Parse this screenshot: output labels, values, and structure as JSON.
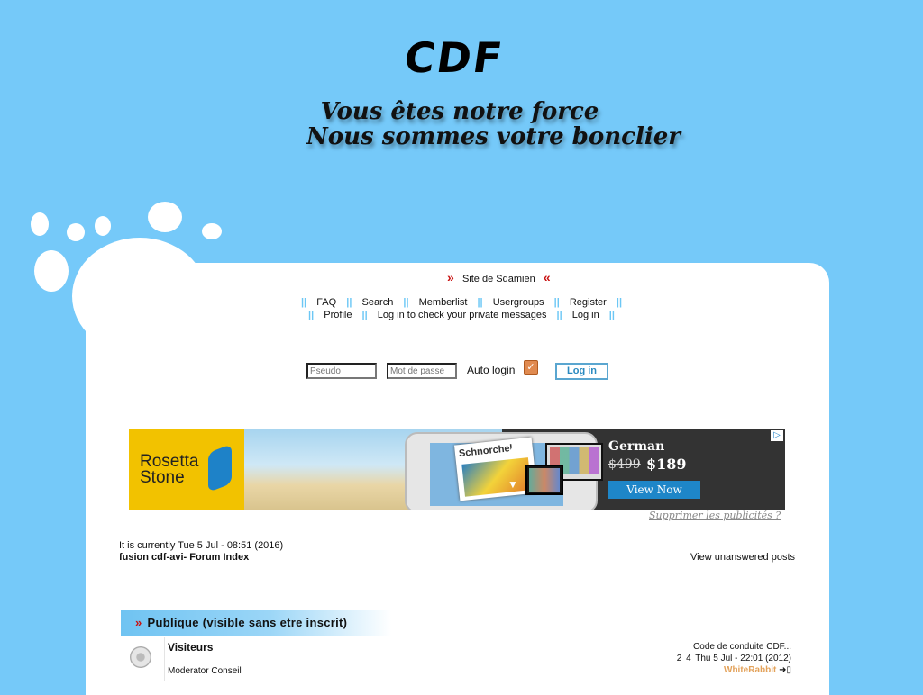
{
  "header": {
    "logo_text": "CDF",
    "slogan_line1": "Vous êtes notre force",
    "slogan_line2": "Nous sommes votre bonclier"
  },
  "site_link": {
    "arrow_left": "»",
    "label": "Site de Sdamien",
    "arrow_right": "«"
  },
  "nav": {
    "row1": [
      "FAQ",
      "Search",
      "Memberlist",
      "Usergroups",
      "Register"
    ],
    "row2": [
      "Profile",
      "Log in to check your private messages",
      "Log in"
    ],
    "separator": "||"
  },
  "login": {
    "username_placeholder": "Pseudo",
    "password_placeholder": "Mot de passe",
    "autologin_label": "Auto login",
    "autologin_checked": true,
    "button_label": "Log in"
  },
  "ad": {
    "brand": "Rosetta Stone",
    "tablet_label": "Schnorchel",
    "language": "German",
    "old_price": "$499",
    "new_price": "$189",
    "cta": "View Now",
    "remove_ads": "Supprimer les publicités ?"
  },
  "forum": {
    "current_time": "It is currently Tue 5 Jul - 08:51 (2016)",
    "index_title": "fusion cdf-avi- Forum Index",
    "view_unanswered": "View unanswered posts",
    "category": {
      "arrow": "»",
      "title": "Publique (visible sans etre inscrit)"
    },
    "rows": [
      {
        "name": "Visiteurs",
        "moderator": "Moderator Conseil",
        "last_topic": "Code de conduite CDF...",
        "topics": "2",
        "posts": "4",
        "last_date": "Thu 5 Jul - 22:01 (2012)",
        "last_user": "WhiteRabbit"
      }
    ]
  },
  "colors": {
    "background": "#75c9f9",
    "panel": "#ffffff",
    "accent_red": "#c81010",
    "user_orange": "#e3a25a"
  }
}
